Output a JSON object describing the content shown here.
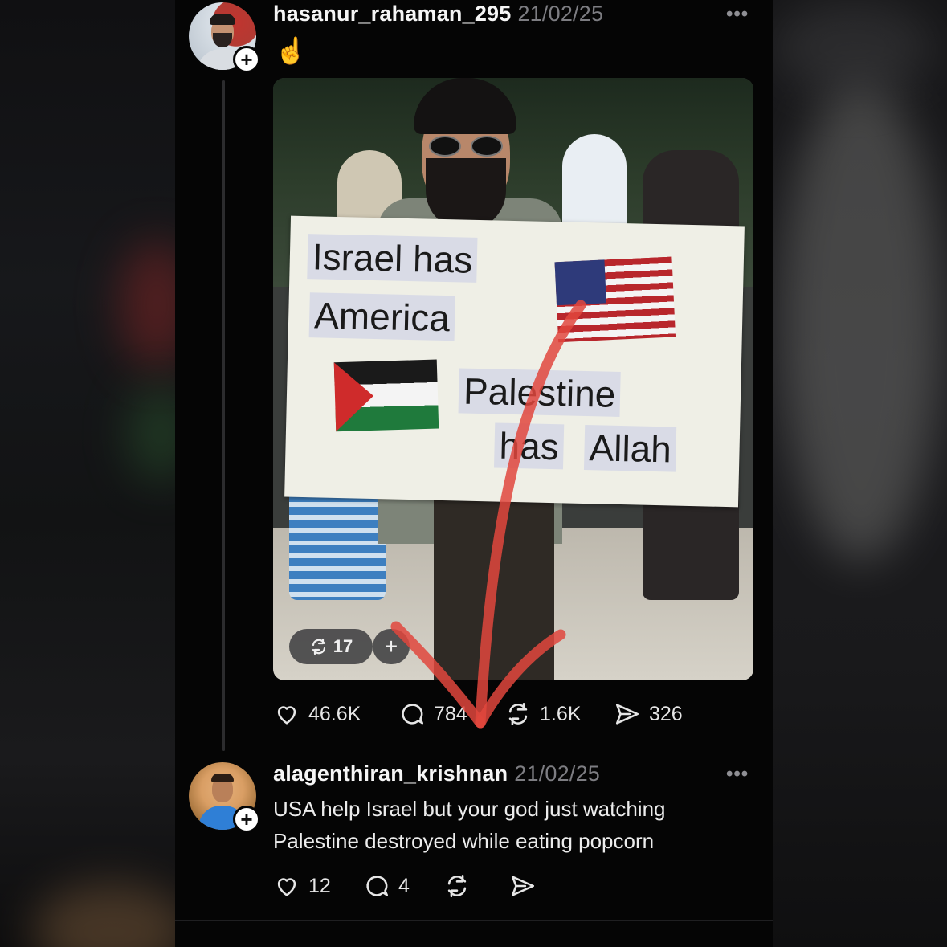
{
  "post": {
    "username": "hasanur_rahaman_295",
    "date": "21/02/25",
    "more": "•••",
    "emoji": "☝️",
    "follow_symbol": "+",
    "image": {
      "sign_lines": [
        "Israel has",
        "America",
        "Palestine",
        "has",
        "Allah"
      ],
      "repost_count_label": "17",
      "plus_symbol": "+"
    },
    "stats": {
      "likes": "46.6K",
      "replies": "784",
      "reposts": "1.6K",
      "shares": "326"
    }
  },
  "reply": {
    "username": "alagenthiran_krishnan",
    "date": "21/02/25",
    "more": "•••",
    "follow_symbol": "+",
    "text_line1": "USA help Israel but your god just watching",
    "text_line2": "Palestine destroyed while eating popcorn",
    "stats": {
      "likes": "12",
      "replies": "4"
    }
  },
  "colors": {
    "background": "#050505",
    "text": "#f5f5f5",
    "muted": "#7d7d82",
    "annotation_arrow": "#e0463d"
  },
  "icons": [
    "heart-icon",
    "reply-icon",
    "repost-icon",
    "share-icon",
    "more-icon",
    "follow-plus-icon"
  ]
}
